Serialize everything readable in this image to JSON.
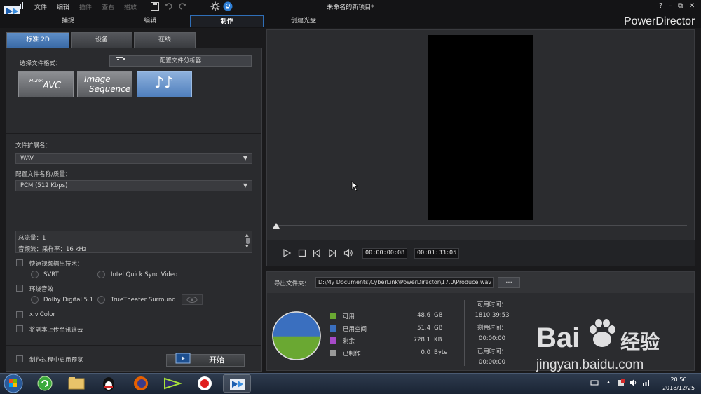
{
  "menu": {
    "file": "文件",
    "edit": "编辑",
    "plugin": "插件",
    "view": "查看",
    "play": "播放"
  },
  "window_title": "未命名的新项目*",
  "window_controls": {
    "help": "?",
    "minimize": "–",
    "restore": "⧉",
    "close": "✕"
  },
  "mode_tabs": {
    "capture": "捕捉",
    "edit": "编辑",
    "produce": "制作",
    "disc": "创建光盘"
  },
  "brand": "PowerDirector",
  "subtabs": {
    "standard2d": "标准 2D",
    "device": "设备",
    "online": "在线"
  },
  "format": {
    "label": "选择文件格式：",
    "analyzer_button": "配置文件分析器",
    "avc_top": "H.264",
    "avc_main": "AVC",
    "image_seq_1": "Image",
    "image_seq_2": "Sequence",
    "audio_glyph": "♪♪"
  },
  "file_ext": {
    "label": "文件扩展名：",
    "value": "WAV"
  },
  "profile": {
    "label": "配置文件名称/质量：",
    "value": "PCM (512 Kbps)"
  },
  "info": {
    "line1": "总流量：1",
    "line2": "音频流：采样率：16 kHz"
  },
  "options": {
    "fast_render": "快速视频输出技术：",
    "svrt": "SVRT",
    "intel_qsv": "Intel Quick Sync Video",
    "surround": "环绕音效",
    "dolby": "Dolby Digital 5.1",
    "truetheater": "TrueTheater Surround",
    "xvcolor": "x.v.Color",
    "upload_copy": "将副本上传至讯连云",
    "preview_during": "制作过程中启用预览"
  },
  "start_button": "开始",
  "player": {
    "current_time": "00:00:00:08",
    "duration": "00:01:33:05"
  },
  "output": {
    "folder_label": "导出文件夹：",
    "folder_path": "D:\\My Documents\\CyberLink\\PowerDirector\\17.0\\Produce.wav",
    "browse": "..."
  },
  "disk": {
    "items": [
      {
        "label": "可用",
        "value": "48.6",
        "unit": "GB",
        "color": "#6aa832"
      },
      {
        "label": "已用空间",
        "value": "51.4",
        "unit": "GB",
        "color": "#3a6fbf"
      },
      {
        "label": "剩余",
        "value": "728.1",
        "unit": "KB",
        "color": "#a64ac8"
      },
      {
        "label": "已制作",
        "value": "0.0",
        "unit": "Byte",
        "color": "#9a9a9a"
      }
    ],
    "free_fraction": 0.486
  },
  "time_info": {
    "available_label": "可用时间：",
    "available_value": "1810:39:53",
    "remaining_label": "剩余时间：",
    "remaining_value": "00:00:00",
    "elapsed_label": "已用时间：",
    "elapsed_value": "00:00:00"
  },
  "watermark": {
    "brand": "Bai",
    "brand_cn": "经验",
    "url": "jingyan.baidu.com"
  },
  "taskbar": {
    "time": "20:56",
    "date": "2018/12/25"
  }
}
